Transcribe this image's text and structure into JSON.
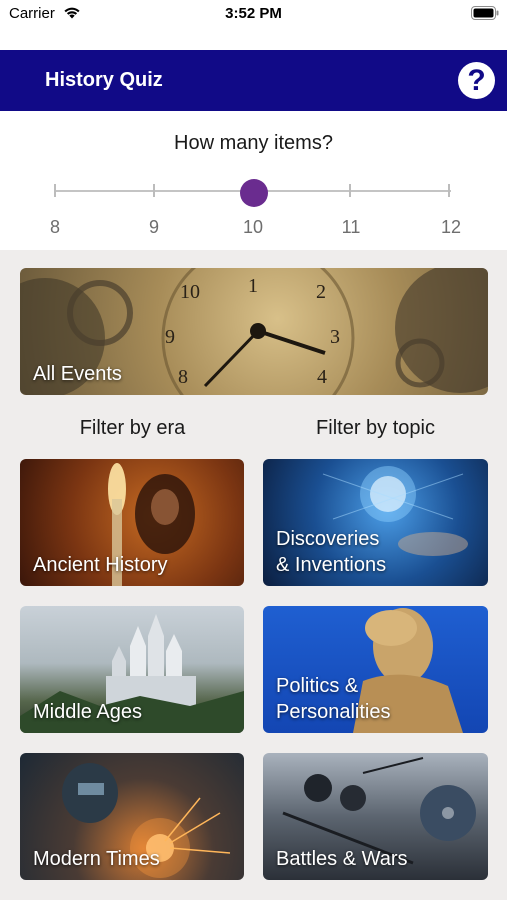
{
  "status_bar": {
    "carrier": "Carrier",
    "time": "3:52 PM"
  },
  "nav": {
    "title": "History Quiz",
    "help_icon": "question-mark-circle-icon",
    "bar_color": "#110a87"
  },
  "item_count": {
    "question": "How many items?",
    "options": [
      "8",
      "9",
      "10",
      "11",
      "12"
    ],
    "selected": "10",
    "thumb_color": "#6a2c8f"
  },
  "cards": {
    "all_events": "All Events",
    "filter_by_era": "Filter by era",
    "filter_by_topic": "Filter by topic",
    "ancient_history": "Ancient History",
    "discoveries_line1": "Discoveries",
    "discoveries_line2": "& Inventions",
    "middle_ages": "Middle Ages",
    "politics_line1": "Politics &",
    "politics_line2": "Personalities",
    "modern_times": "Modern Times",
    "battles_wars": "Battles & Wars"
  }
}
